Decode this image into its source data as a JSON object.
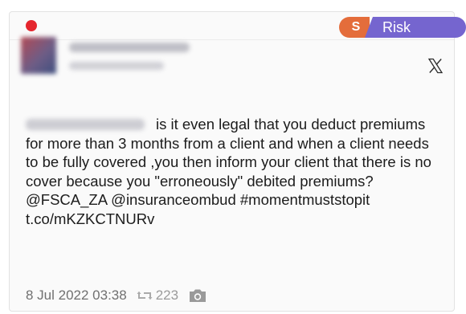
{
  "header": {
    "status_color": "#e5262e",
    "tag_letter": "S",
    "tag_label": "Risk",
    "tag_letter_color": "#e46d3b",
    "tag_label_color": "#7565cf"
  },
  "author": {
    "avatar_icon": "blurred-avatar",
    "platform_icon": "x-logo-icon"
  },
  "tweet": {
    "text": "is it even legal that you deduct premiums for more than 3 months from a client and when a client needs to be fully covered ,you then inform your client that there is no cover because you \"erroneously\" debited premiums? @FSCA_ZA @insuranceombud #momentmuststopit t.co/mKZKCTNURv"
  },
  "meta": {
    "date": "8 Jul 2022 03:38",
    "retweet_count": "223",
    "retweet_icon": "retweet-icon",
    "media_icon": "camera-icon"
  }
}
